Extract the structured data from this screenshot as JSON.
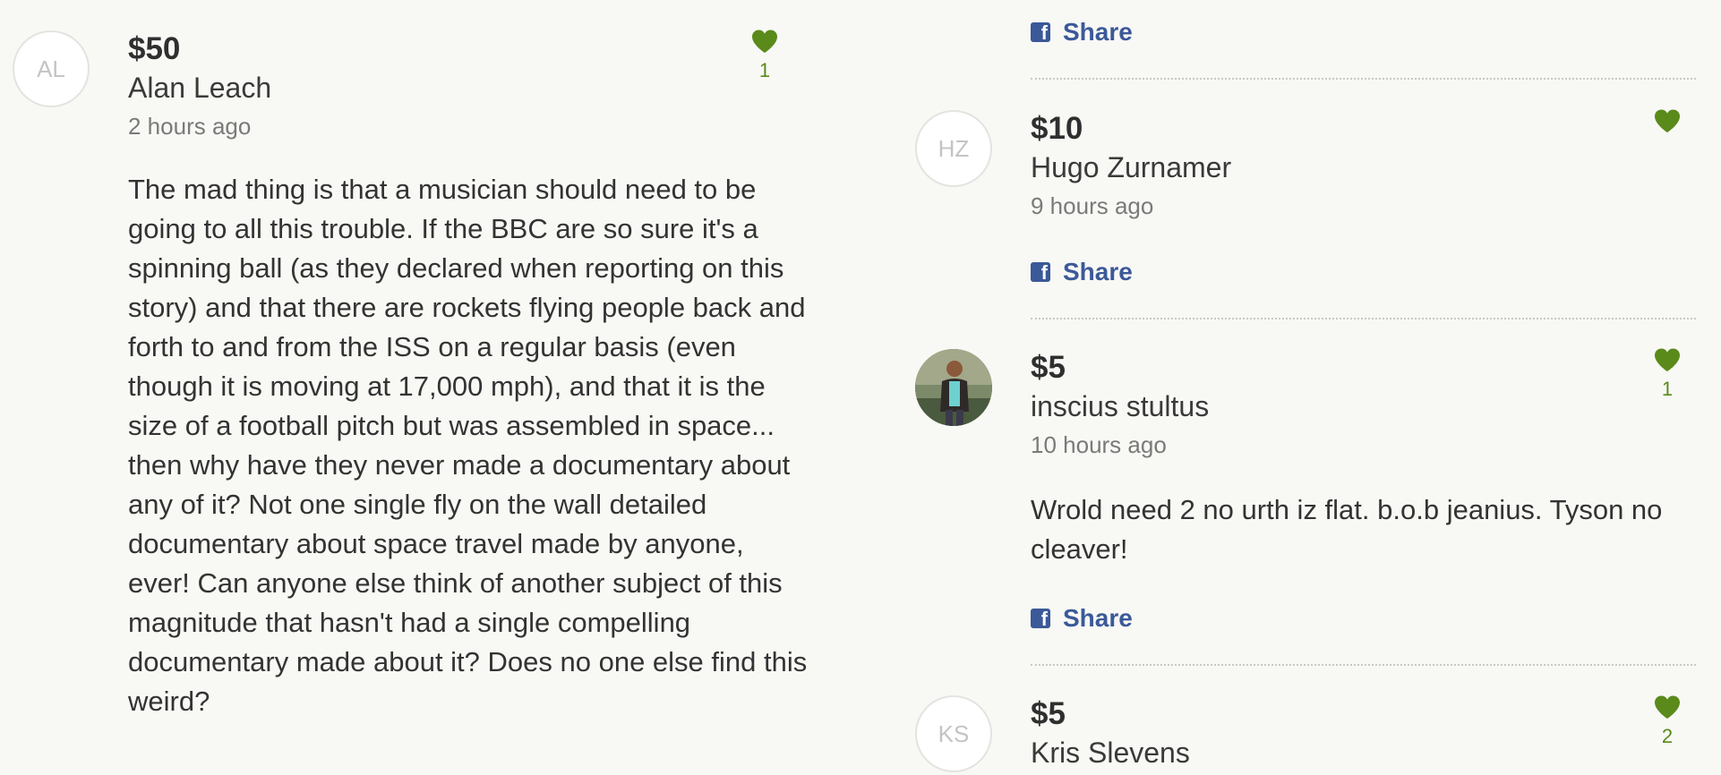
{
  "colors": {
    "heart": "#5a8a1a",
    "share": "#3b5998",
    "background": "#f8f8f5"
  },
  "left_comment": {
    "avatar_initials": "AL",
    "amount": "$50",
    "name": "Alan Leach",
    "time": "2 hours ago",
    "likes": "1",
    "text": "The mad thing is that a musician should need to be going to all this trouble. If the BBC are so sure it's a spinning ball (as they declared when reporting on this story) and that there are rockets flying people back and forth to and from the ISS on a regular basis (even though it is moving at 17,000 mph), and that it is the size of a football pitch but was assembled in space... then why have they never made a documentary about any of it? Not one single fly on the wall detailed documentary about space travel made by anyone, ever! Can anyone else think of another subject of this magnitude that hasn't had a single compelling documentary made about it? Does no one else find this weird?"
  },
  "right_column": {
    "top_share_label": "Share",
    "comments": [
      {
        "avatar_initials": "HZ",
        "amount": "$10",
        "name": "Hugo Zurnamer",
        "time": "9 hours ago",
        "likes": "",
        "share_label": "Share"
      },
      {
        "avatar_initials": "",
        "avatar_icon": "user-photo",
        "amount": "$5",
        "name": "inscius stultus",
        "time": "10 hours ago",
        "likes": "1",
        "text": "Wrold need 2 no urth iz flat. b.o.b jeanius. Tyson no cleaver!",
        "share_label": "Share"
      },
      {
        "avatar_initials": "KS",
        "amount": "$5",
        "name": "Kris Slevens",
        "likes": "2"
      }
    ]
  }
}
